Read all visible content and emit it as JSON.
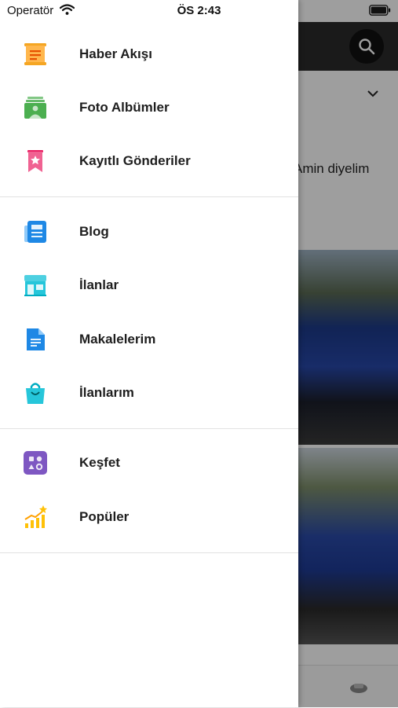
{
  "status_bar": {
    "carrier": "Operatör",
    "time": "ÖS 2:43"
  },
  "background": {
    "partial_text": "Amin diyelim",
    "icons": [
      "search-icon",
      "chevron-down-icon",
      "avatar"
    ]
  },
  "menu": {
    "group1": [
      {
        "label": "Haber Akışı",
        "icon": "newspaper-icon"
      },
      {
        "label": "Foto Albümler",
        "icon": "photo-album-icon"
      },
      {
        "label": "Kayıtlı Gönderiler",
        "icon": "bookmark-icon"
      }
    ],
    "group2": [
      {
        "label": "Blog",
        "icon": "blog-icon"
      },
      {
        "label": "İlanlar",
        "icon": "store-icon"
      },
      {
        "label": "Makalelerim",
        "icon": "document-icon"
      },
      {
        "label": "İlanlarım",
        "icon": "shopping-bag-icon"
      }
    ],
    "group3": [
      {
        "label": "Keşfet",
        "icon": "explore-icon"
      },
      {
        "label": "Popüler",
        "icon": "trending-icon"
      }
    ]
  },
  "colors": {
    "orange": "#f5a623",
    "green": "#4caf50",
    "pink": "#f06292",
    "blue": "#1e88e5",
    "cyan": "#26c6da",
    "purple": "#7e57c2",
    "gold": "#ffc107"
  }
}
